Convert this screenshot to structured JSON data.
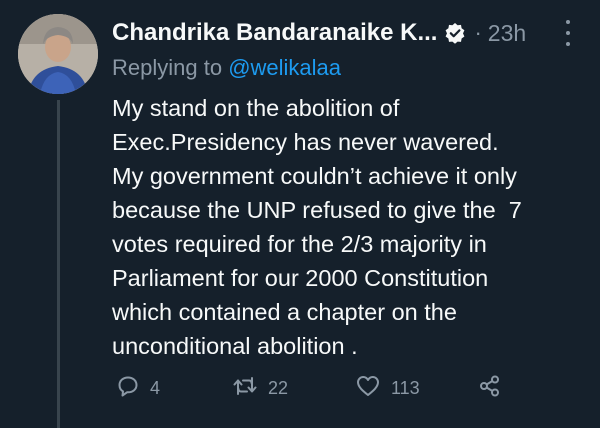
{
  "tweet": {
    "author_name": "Chandrika Bandaranaike K...",
    "time": "23h",
    "separator": "·",
    "replying_prefix": "Replying to ",
    "replying_handle": "@welikalaa",
    "text_lines": [
      "My stand on the abolition of",
      "Exec.Presidency has never wavered.",
      "My government couldn’t achieve it only",
      "because the UNP refused to give the  7",
      "votes required for the 2/3 majority in",
      "Parliament for our 2000 Constitution",
      "which contained a chapter on the",
      "unconditional abolition ."
    ]
  },
  "actions": {
    "reply_count": "4",
    "retweet_count": "22",
    "like_count": "113"
  },
  "icons": {
    "verified": "verified-badge-icon",
    "more": "more-options-icon",
    "reply": "reply-icon",
    "retweet": "retweet-icon",
    "like": "heart-icon",
    "share": "share-icon"
  },
  "colors": {
    "background": "#15202b",
    "text": "#f7f9f9",
    "secondary": "#8b98a5",
    "link": "#1d9bf0",
    "thread_line": "#38444d"
  }
}
